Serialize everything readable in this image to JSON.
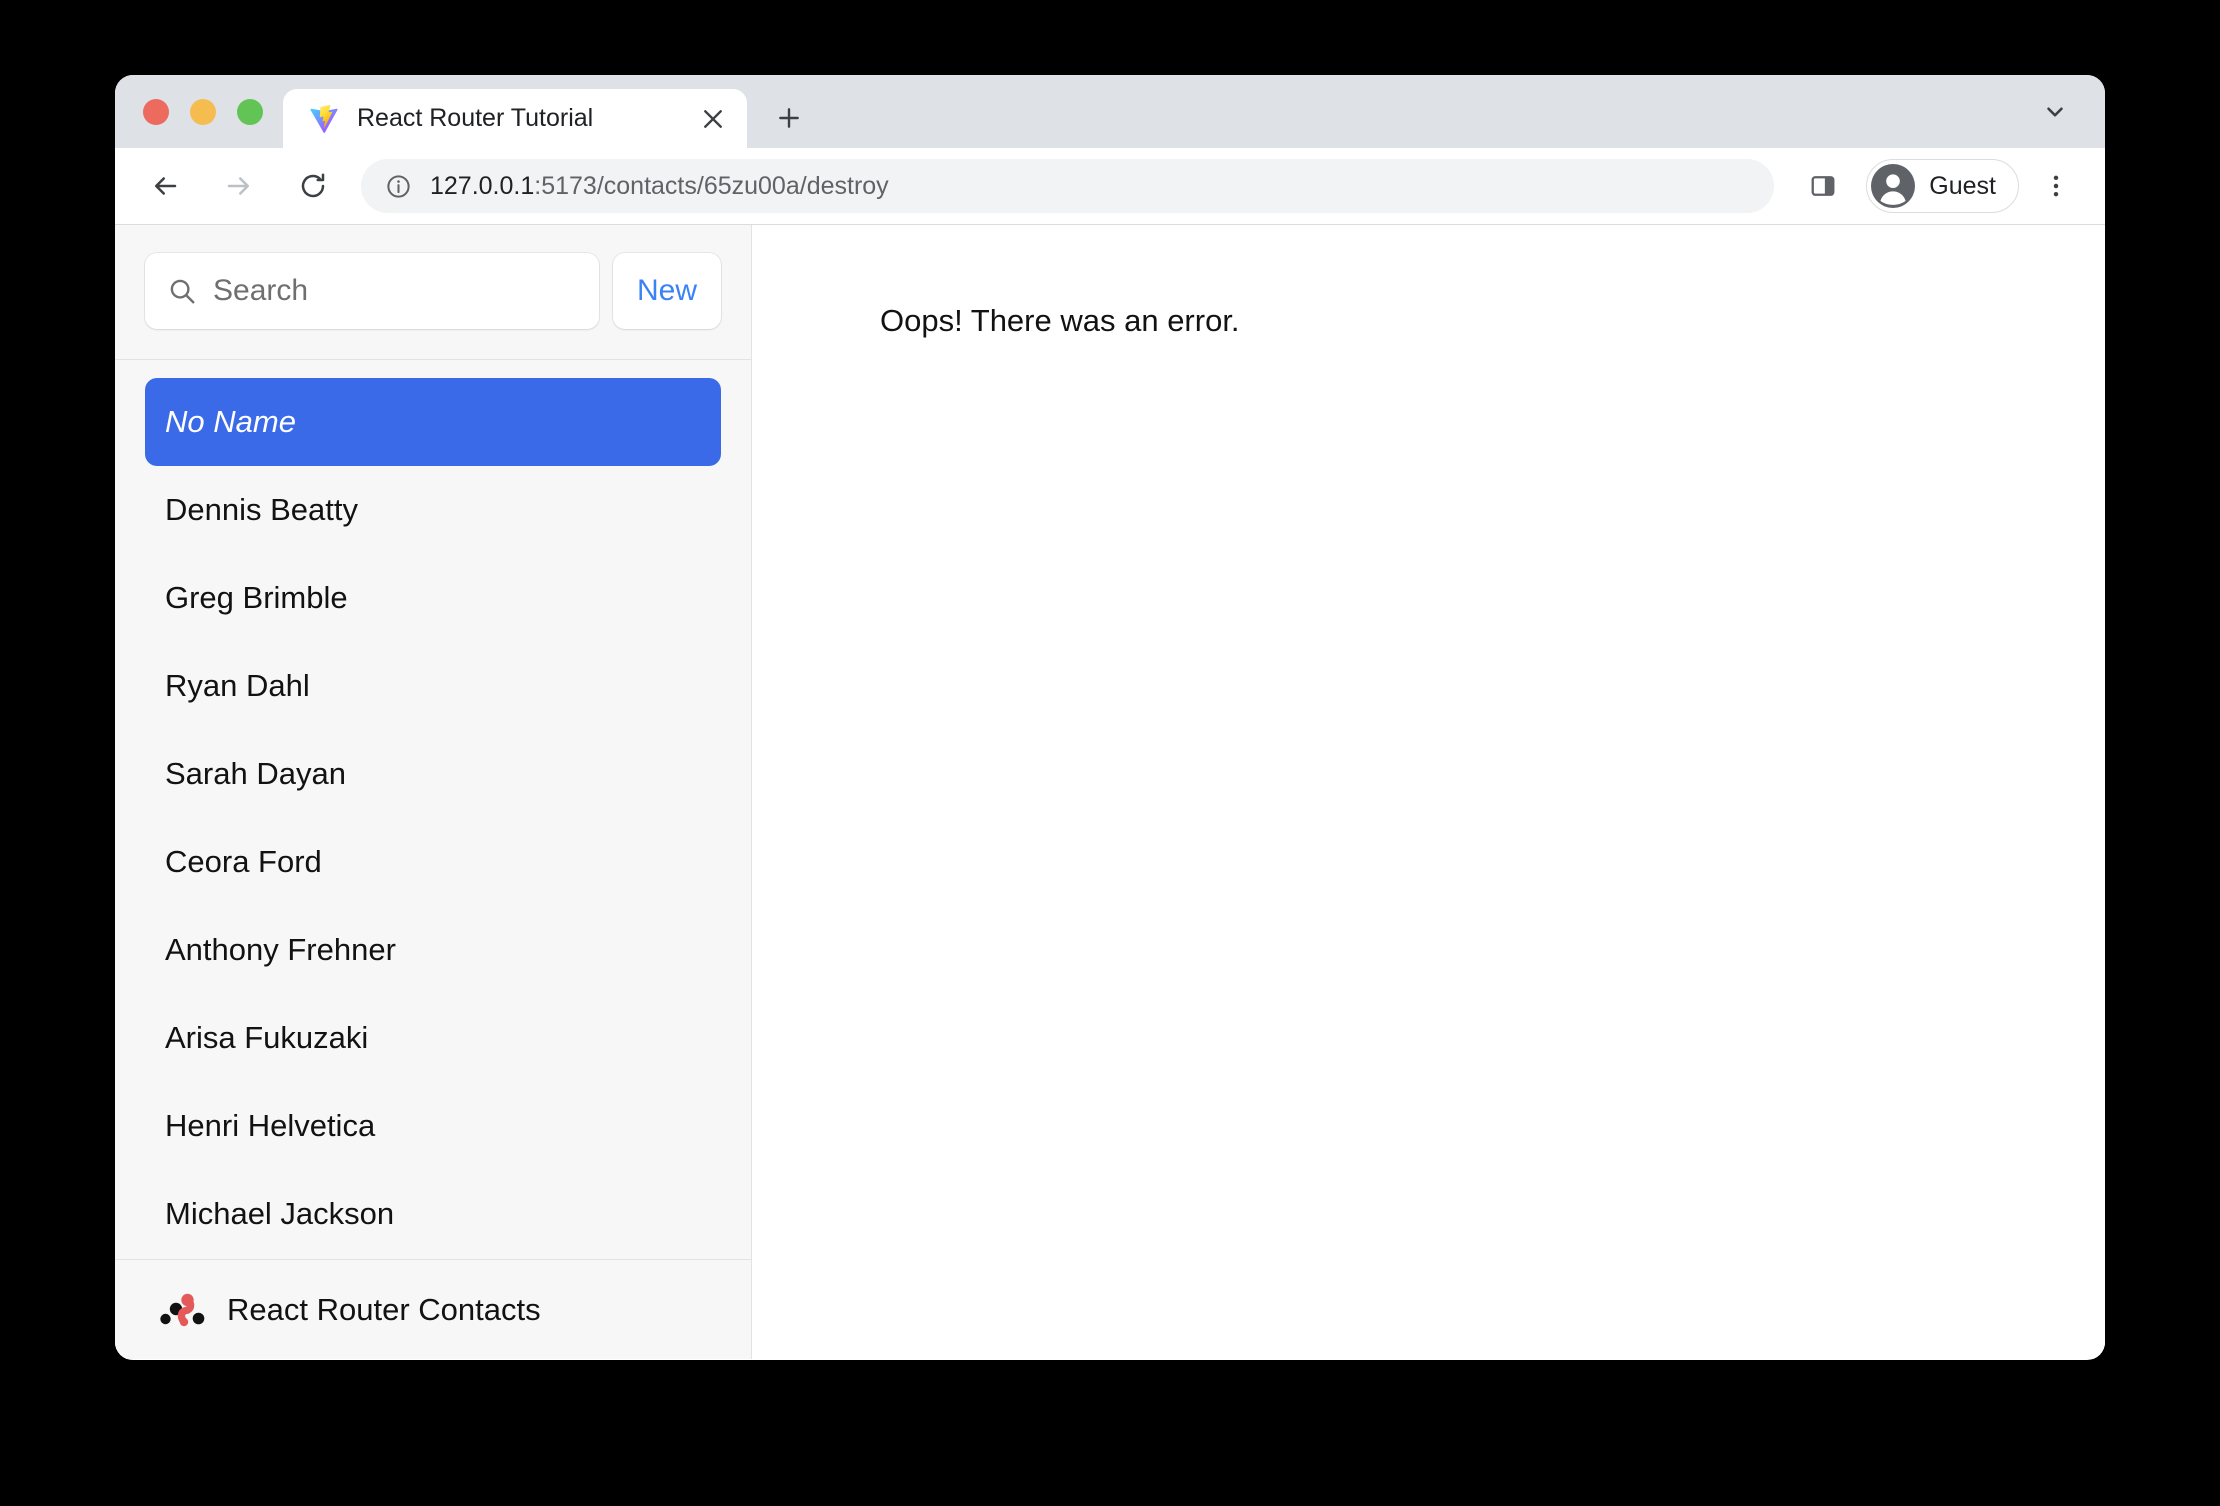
{
  "browser": {
    "tab": {
      "title": "React Router Tutorial",
      "favicon": "vite-icon",
      "close_label": "close-tab"
    },
    "new_tab_label": "new-tab",
    "tab_search_label": "tab-search",
    "toolbar": {
      "back_label": "Back",
      "forward_label": "Forward",
      "reload_label": "Reload",
      "site_info_label": "site-information",
      "url_host": "127.0.0.1",
      "url_path": ":5173/contacts/65zu00a/destroy",
      "url_full": "127.0.0.1:5173/contacts/65zu00a/destroy",
      "side_panel_label": "side-panel",
      "profile_name": "Guest",
      "menu_label": "Customize and control"
    },
    "window_controls": {
      "close": "close-window",
      "minimize": "minimize-window",
      "zoom": "zoom-window"
    }
  },
  "colors": {
    "accent_blue": "#3b6ae8",
    "link_blue": "#3b82f6",
    "sidebar_bg": "#f7f7f7",
    "traffic_red": "#ed6a5e",
    "traffic_yellow": "#f5bd4f",
    "traffic_green": "#61c454",
    "logo_red": "#e45a5a"
  },
  "sidebar": {
    "search": {
      "placeholder": "Search",
      "value": ""
    },
    "new_button_label": "New",
    "contacts": [
      {
        "name": "No Name",
        "active": true,
        "italic": true
      },
      {
        "name": "Dennis Beatty",
        "active": false,
        "italic": false
      },
      {
        "name": "Greg Brimble",
        "active": false,
        "italic": false
      },
      {
        "name": "Ryan Dahl",
        "active": false,
        "italic": false
      },
      {
        "name": "Sarah Dayan",
        "active": false,
        "italic": false
      },
      {
        "name": "Ceora Ford",
        "active": false,
        "italic": false
      },
      {
        "name": "Anthony Frehner",
        "active": false,
        "italic": false
      },
      {
        "name": "Arisa Fukuzaki",
        "active": false,
        "italic": false
      },
      {
        "name": "Henri Helvetica",
        "active": false,
        "italic": false
      },
      {
        "name": "Michael Jackson",
        "active": false,
        "italic": false
      }
    ],
    "footer_title": "React Router Contacts"
  },
  "main": {
    "error_message": "Oops! There was an error."
  }
}
